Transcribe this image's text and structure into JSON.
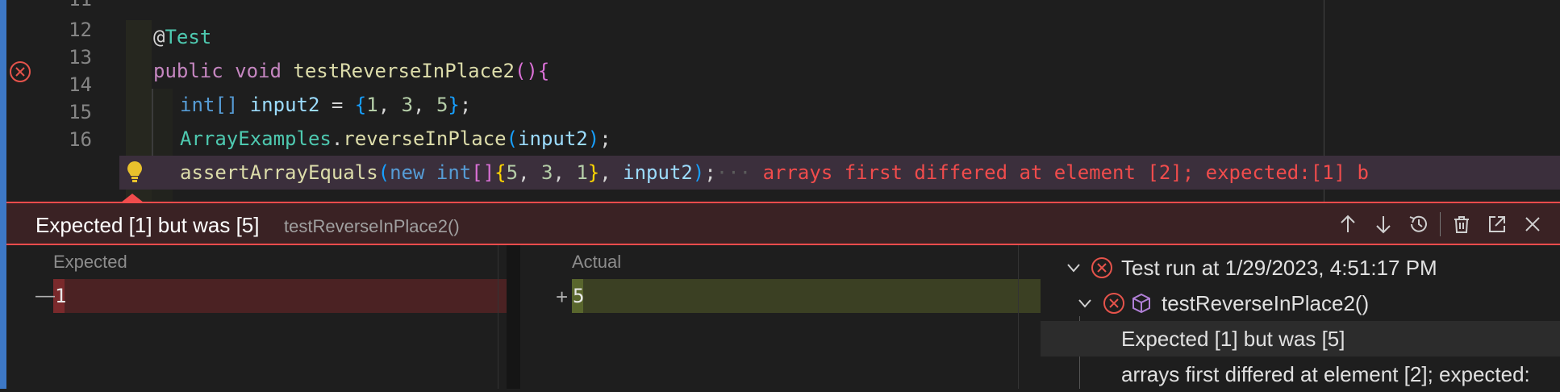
{
  "editor": {
    "gutter": {
      "line_numbers": [
        "11",
        "12",
        "13",
        "14",
        "15",
        "16"
      ],
      "error_line": "13"
    },
    "code": {
      "line12_at": "@",
      "line12_annotation": "Test",
      "line13_kw1": "public",
      "line13_kw2": "void",
      "line13_fn": "testReverseInPlace2",
      "line13_parens": "()",
      "line13_brace": "{",
      "line14_type": "int",
      "line14_brackets": "[]",
      "line14_var": "input2",
      "line14_eq": "=",
      "line14_open": "{",
      "line14_n1": "1",
      "line14_n2": "3",
      "line14_n3": "5",
      "line14_close": "}",
      "line14_end": ";",
      "line15_class": "ArrayExamples",
      "line15_fn": "reverseInPlace",
      "line15_arg": "input2",
      "line16_fn": "assertArrayEquals",
      "line16_new": "new",
      "line16_type": "int",
      "line16_n1": "5",
      "line16_n2": "3",
      "line16_n3": "1",
      "line16_arg": "input2",
      "line16_inline_error": "arrays first differed at element [2]; expected:[1] b"
    }
  },
  "peek": {
    "title": "Expected [1] but was [5]",
    "subtitle": "testReverseInPlace2()",
    "actions": [
      "arrow-up-icon",
      "arrow-down-icon",
      "history-icon",
      "trash-icon",
      "open-external-icon",
      "close-icon"
    ]
  },
  "diff": {
    "expected_label": "Expected",
    "expected_sign": "—",
    "expected_value": "1",
    "actual_label": "Actual",
    "actual_sign": "+",
    "actual_value": "5"
  },
  "tree": {
    "run_label": "Test run at 1/29/2023, 4:51:17 PM",
    "test_label": "testReverseInPlace2()",
    "message": "Expected [1] but was [5]",
    "detail": "arrays first differed at element [2]; expected:"
  },
  "colors": {
    "error": "#f14c4c",
    "expected_bg": "#4b2223",
    "actual_bg": "#3b4023",
    "accent": "#3d78c6"
  }
}
